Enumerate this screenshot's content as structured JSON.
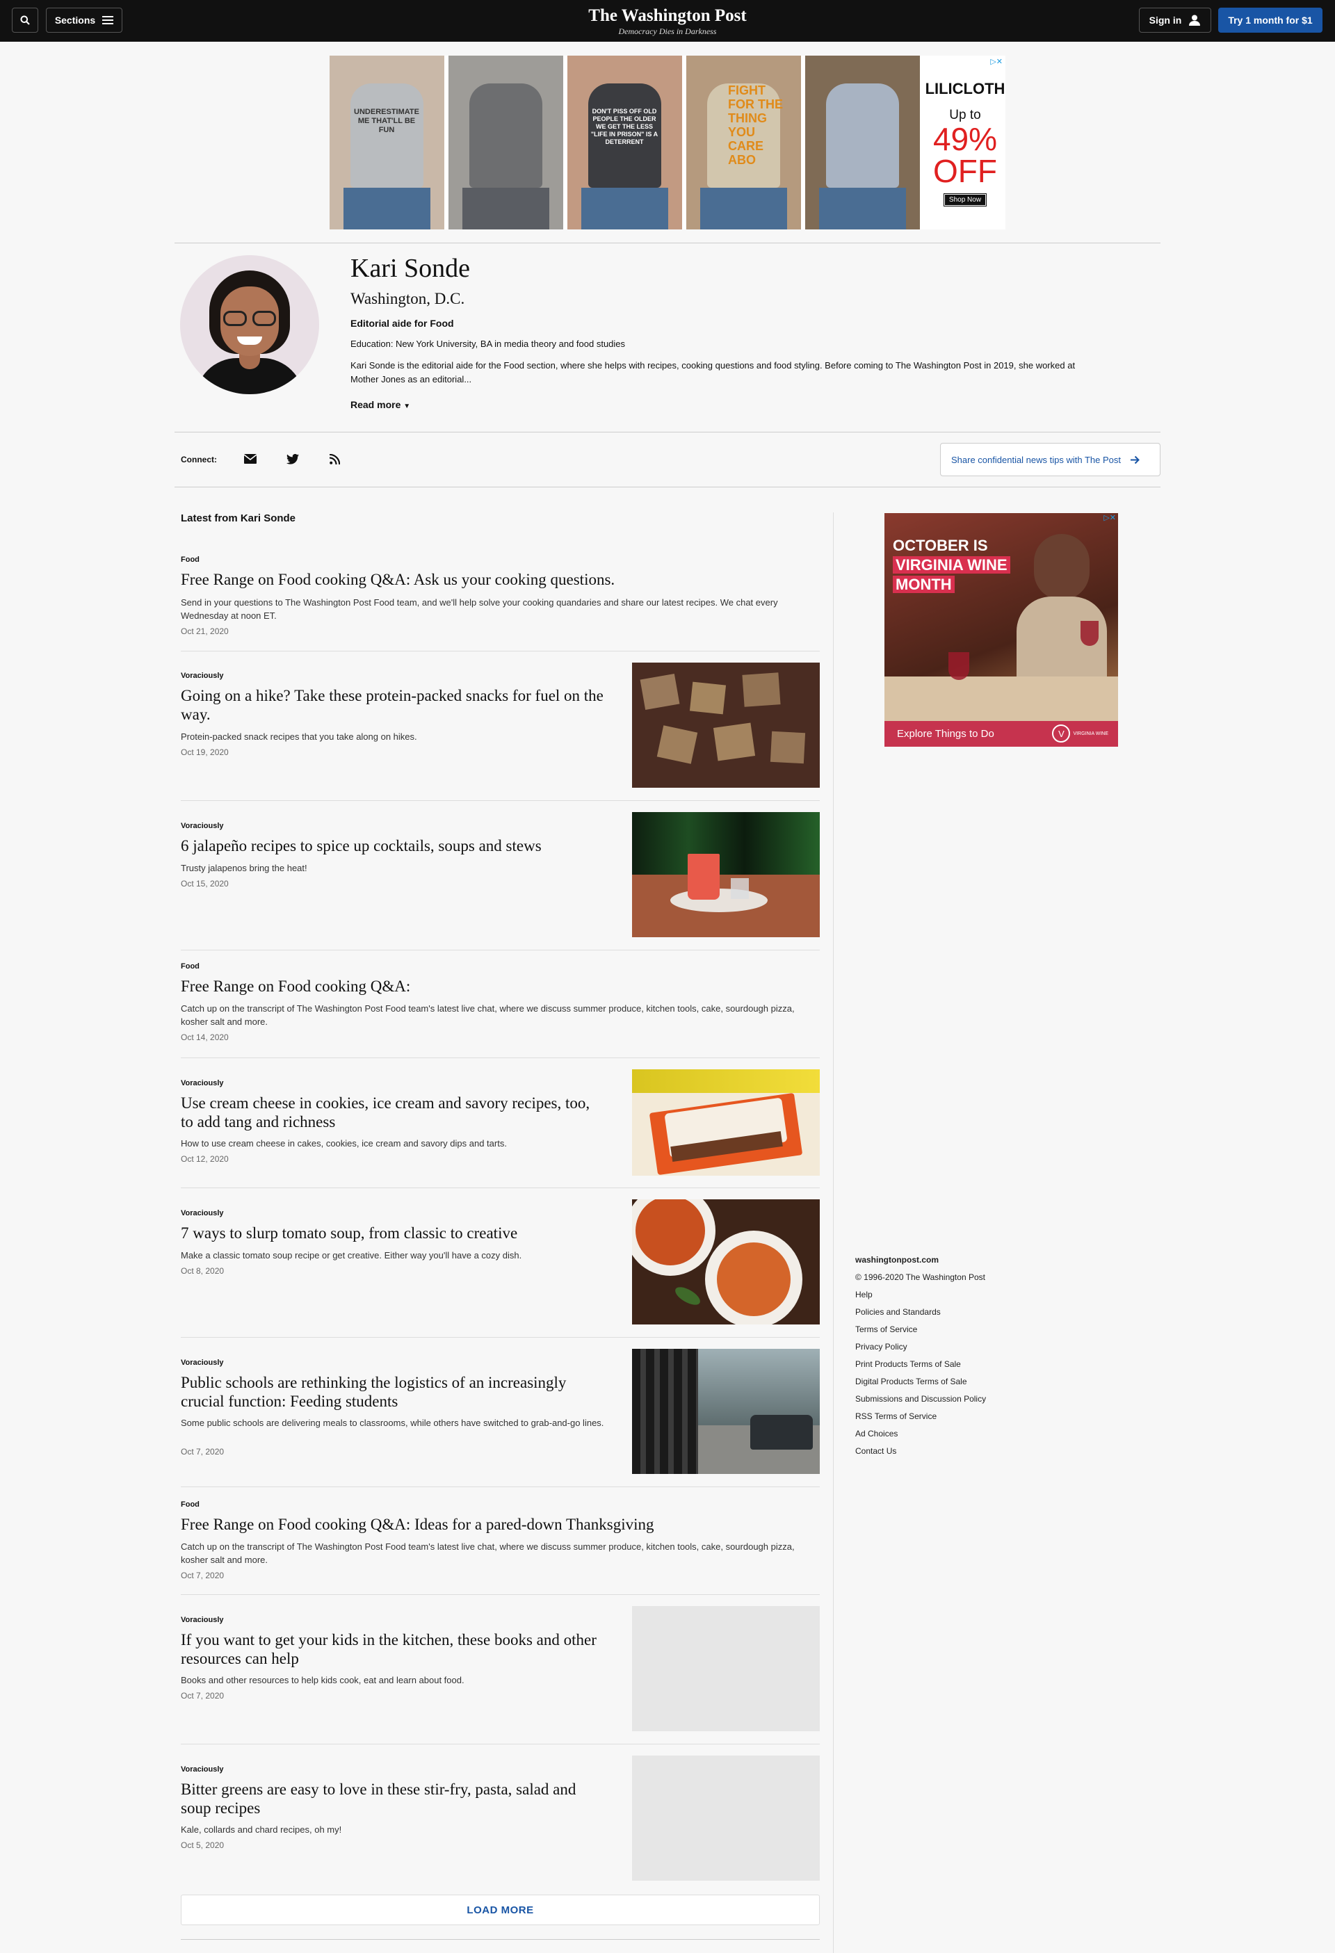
{
  "nav": {
    "sections_label": "Sections",
    "logo": "The Washington Post",
    "tagline": "Democracy Dies in Darkness",
    "signin_label": "Sign in",
    "trial_label": "Try 1 month for $1"
  },
  "top_ad": {
    "shirt_texts": [
      "UNDERESTIMATE ME THAT'LL BE FUN",
      "",
      "DON'T PISS OFF OLD PEOPLE THE OLDER WE GET THE LESS \"LIFE IN PRISON\" IS A DETERRENT",
      "FIGHT FOR THE THING YOU CARE ABO",
      ""
    ],
    "brand": "LILICLOTH",
    "up_to": "Up to",
    "discount": "49%",
    "off": "OFF",
    "cta": "Shop Now"
  },
  "author": {
    "name": "Kari Sonde",
    "location": "Washington, D.C.",
    "role": "Editorial aide for Food",
    "education": "Education: New York University, BA in media theory and food studies",
    "bio": "Kari Sonde is the editorial aide for the Food section, where she helps with recipes, cooking questions and food styling. Before coming to The Washington Post in 2019, she worked at Mother Jones as an editorial...",
    "read_more": "Read more"
  },
  "connect": {
    "label": "Connect:",
    "tip_label": "Share confidential news tips with The Post"
  },
  "feed": {
    "heading": "Latest from Kari Sonde",
    "load_more": "LOAD MORE",
    "items": [
      {
        "kicker": "Food",
        "headline": "Free Range on Food cooking Q&A: Ask us your cooking questions.",
        "blurb": "Send in your questions to The Washington Post Food team, and we'll help solve your cooking quandaries and share our latest recipes. We chat every Wednesday at noon ET.",
        "date": "Oct 21, 2020"
      },
      {
        "kicker": "Voraciously",
        "headline": "Going on a hike? Take these protein-packed snacks for fuel on the way.",
        "blurb": "Protein-packed snack recipes that you take along on hikes.",
        "date": "Oct 19, 2020"
      },
      {
        "kicker": "Voraciously",
        "headline": "6 jalapeño recipes to spice up cocktails, soups and stews",
        "blurb": "Trusty jalapenos bring the heat!",
        "date": "Oct 15, 2020"
      },
      {
        "kicker": "Food",
        "headline": "Free Range on Food cooking Q&A:",
        "blurb": "Catch up on the transcript of The Washington Post Food team's latest live chat, where we discuss summer produce, kitchen tools, cake, sourdough pizza, kosher salt and more.",
        "date": "Oct 14, 2020"
      },
      {
        "kicker": "Voraciously",
        "headline": "Use cream cheese in cookies, ice cream and savory recipes, too, to add tang and richness",
        "blurb": "How to use cream cheese in cakes, cookies, ice cream and savory dips and tarts.",
        "date": "Oct 12, 2020"
      },
      {
        "kicker": "Voraciously",
        "headline": "7 ways to slurp tomato soup, from classic to creative",
        "blurb": "Make a classic tomato soup recipe or get creative. Either way you'll have a cozy dish.",
        "date": "Oct 8, 2020"
      },
      {
        "kicker": "Voraciously",
        "headline": "Public schools are rethinking the logistics of an increasingly crucial function: Feeding students",
        "blurb": "Some public schools are delivering meals to classrooms, while others have switched to grab-and-go lines.",
        "date": "Oct 7, 2020"
      },
      {
        "kicker": "Food",
        "headline": "Free Range on Food cooking Q&A: Ideas for a pared-down Thanksgiving",
        "blurb": "Catch up on the transcript of The Washington Post Food team's latest live chat, where we discuss summer produce, kitchen tools, cake, sourdough pizza, kosher salt and more.",
        "date": "Oct 7, 2020"
      },
      {
        "kicker": "Voraciously",
        "headline": "If you want to get your kids in the kitchen, these books and other resources can help",
        "blurb": "Books and other resources to help kids cook, eat and learn about food.",
        "date": "Oct 7, 2020"
      },
      {
        "kicker": "Voraciously",
        "headline": "Bitter greens are easy to love in these stir-fry, pasta, salad and soup recipes",
        "blurb": "Kale, collards and chard recipes, oh my!",
        "date": "Oct 5, 2020"
      }
    ]
  },
  "side_ad": {
    "line1": "OCTOBER IS",
    "line2": "VIRGINIA WINE",
    "line3": "MONTH",
    "cta": "Explore Things to Do",
    "logo_letter": "V",
    "logo_text": "VIRGINIA WINE"
  },
  "footer": {
    "site": "washingtonpost.com",
    "copyright": "© 1996-2020 The Washington Post",
    "links": [
      "Help",
      "Policies and Standards",
      "Terms of Service",
      "Privacy Policy",
      "Print Products Terms of Sale",
      "Digital Products Terms of Sale",
      "Submissions and Discussion Policy",
      "RSS Terms of Service",
      "Ad Choices",
      "Contact Us"
    ]
  },
  "icons": {
    "search": "search-icon",
    "menu": "hamburger-icon",
    "user": "user-icon",
    "email": "envelope-icon",
    "twitter": "twitter-icon",
    "rss": "rss-icon",
    "arrow": "arrow-right-icon"
  },
  "colors": {
    "brand_blue": "#1955a5",
    "nav_bg": "#111111",
    "page_bg": "#f7f7f7"
  }
}
